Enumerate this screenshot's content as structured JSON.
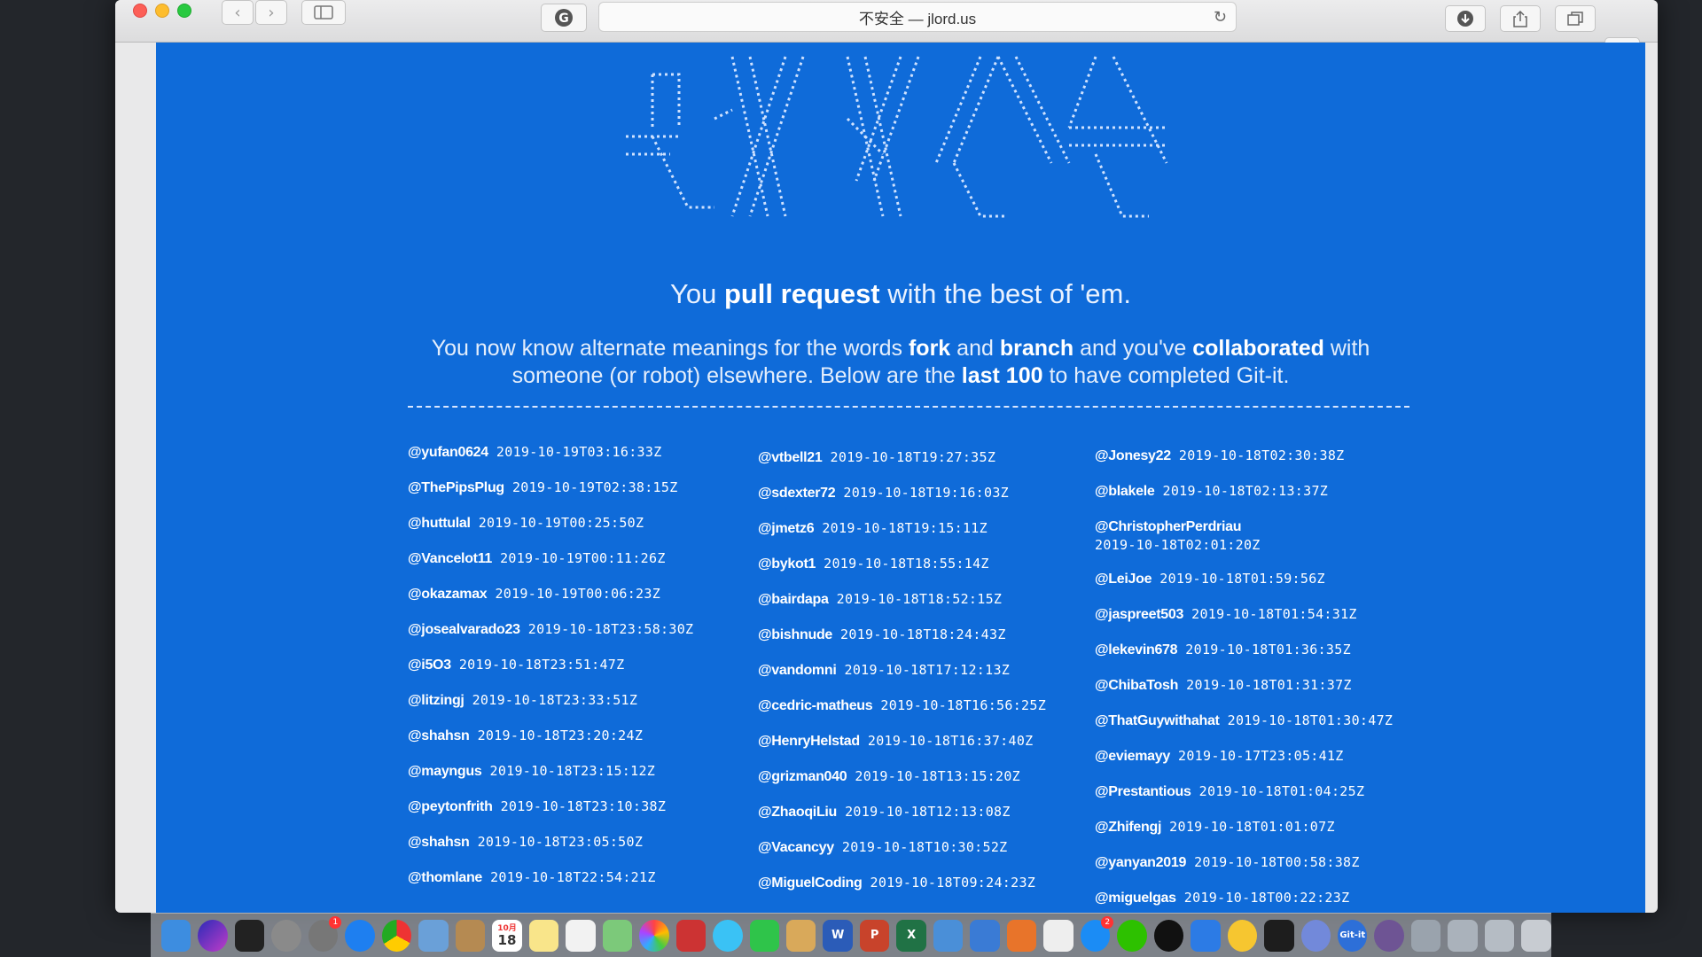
{
  "browser": {
    "address": "不安全 — jlord.us",
    "back_symbol": "‹",
    "forward_symbol": "›"
  },
  "hero": {
    "headline_pre": "You ",
    "headline_bold": "pull request",
    "headline_post": " with the best of 'em.",
    "sub_1": "You now know alternate meanings for the words ",
    "sub_fork": "fork",
    "sub_2": " and ",
    "sub_branch": "branch",
    "sub_3": " and you've ",
    "sub_collab": "collaborated",
    "sub_4": " with someone (or robot) elsewhere. Below are the ",
    "sub_last": "last 100",
    "sub_5": " to have completed Git-it."
  },
  "completions": {
    "col1": [
      {
        "user": "@yufan0624",
        "ts": "2019-10-19T03:16:33Z"
      },
      {
        "user": "@ThePipsPlug",
        "ts": "2019-10-19T02:38:15Z"
      },
      {
        "user": "@huttulal",
        "ts": "2019-10-19T00:25:50Z"
      },
      {
        "user": "@Vancelot11",
        "ts": "2019-10-19T00:11:26Z"
      },
      {
        "user": "@okazamax",
        "ts": "2019-10-19T00:06:23Z"
      },
      {
        "user": "@josealvarado23",
        "ts": "2019-10-18T23:58:30Z"
      },
      {
        "user": "@i5O3",
        "ts": "2019-10-18T23:51:47Z"
      },
      {
        "user": "@litzingj",
        "ts": "2019-10-18T23:33:51Z"
      },
      {
        "user": "@shahsn",
        "ts": "2019-10-18T23:20:24Z"
      },
      {
        "user": "@mayngus",
        "ts": "2019-10-18T23:15:12Z"
      },
      {
        "user": "@peytonfrith",
        "ts": "2019-10-18T23:10:38Z"
      },
      {
        "user": "@shahsn",
        "ts": "2019-10-18T23:05:50Z"
      },
      {
        "user": "@thomlane",
        "ts": "2019-10-18T22:54:21Z"
      }
    ],
    "col2": [
      {
        "user": "@vtbell21",
        "ts": "2019-10-18T19:27:35Z"
      },
      {
        "user": "@sdexter72",
        "ts": "2019-10-18T19:16:03Z"
      },
      {
        "user": "@jmetz6",
        "ts": "2019-10-18T19:15:11Z"
      },
      {
        "user": "@bykot1",
        "ts": "2019-10-18T18:55:14Z"
      },
      {
        "user": "@bairdapa",
        "ts": "2019-10-18T18:52:15Z"
      },
      {
        "user": "@bishnude",
        "ts": "2019-10-18T18:24:43Z"
      },
      {
        "user": "@vandomni",
        "ts": "2019-10-18T17:12:13Z"
      },
      {
        "user": "@cedric-matheus",
        "ts": "2019-10-18T16:56:25Z"
      },
      {
        "user": "@HenryHelstad",
        "ts": "2019-10-18T16:37:40Z"
      },
      {
        "user": "@grizman040",
        "ts": "2019-10-18T13:15:20Z"
      },
      {
        "user": "@ZhaoqiLiu",
        "ts": "2019-10-18T12:13:08Z"
      },
      {
        "user": "@Vacancyy",
        "ts": "2019-10-18T10:30:52Z"
      },
      {
        "user": "@MiguelCoding",
        "ts": "2019-10-18T09:24:23Z"
      }
    ],
    "col3": [
      {
        "user": "@Jonesy22",
        "ts": "2019-10-18T02:30:38Z"
      },
      {
        "user": "@blakele",
        "ts": "2019-10-18T02:13:37Z"
      },
      {
        "user": "@ChristopherPerdriau",
        "ts": "2019-10-18T02:01:20Z"
      },
      {
        "user": "@LeiJoe",
        "ts": "2019-10-18T01:59:56Z"
      },
      {
        "user": "@jaspreet503",
        "ts": "2019-10-18T01:54:31Z"
      },
      {
        "user": "@lekevin678",
        "ts": "2019-10-18T01:36:35Z"
      },
      {
        "user": "@ChibaTosh",
        "ts": "2019-10-18T01:31:37Z"
      },
      {
        "user": "@ThatGuywithahat",
        "ts": "2019-10-18T01:30:47Z"
      },
      {
        "user": "@eviemayy",
        "ts": "2019-10-17T23:05:41Z"
      },
      {
        "user": "@Prestantious",
        "ts": "2019-10-18T01:04:25Z"
      },
      {
        "user": "@Zhifengj",
        "ts": "2019-10-18T01:01:07Z"
      },
      {
        "user": "@yanyan2019",
        "ts": "2019-10-18T00:58:38Z"
      },
      {
        "user": "@miguelgas",
        "ts": "2019-10-18T00:22:23Z"
      }
    ]
  },
  "dock": {
    "calendar_day": "18",
    "calendar_month": "10月",
    "notification_badge": "1",
    "app_store_badge": "2",
    "gitit_label": "Git-it",
    "word_label": "W",
    "ppt_label": "P",
    "excel_label": "X"
  },
  "colors": {
    "page_background": "#0f6bd9",
    "text": "#ffffff"
  }
}
